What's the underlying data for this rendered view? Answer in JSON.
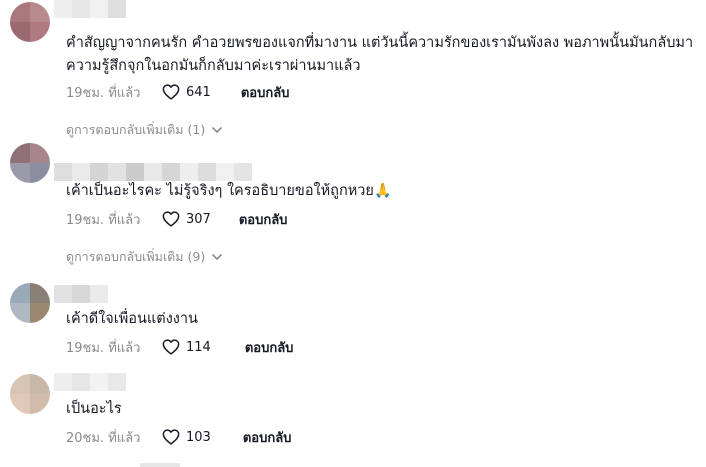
{
  "comments": [
    {
      "text": "คำสัญญาจากคนรัก คำอวยพรของแจกที่มางาน แต่วันนี้ความรักของเรามันพังลง พอภาพนั้นมันกลับมาความรู้สึกจุกในอกมันก็กลับมาค่ะเราผ่านมาแล้ว",
      "time": "19ชม. ที่แล้ว",
      "likes": "641",
      "reply_label": "ตอบกลับ",
      "more_replies": "ดูการตอบกลับเพิ่มเติม (1)"
    },
    {
      "text": "เค้าเป็นอะไรคะ ไม่รู้จริงๆ ใครอธิบายขอให้ถูกหวย",
      "emoji": "🙏",
      "time": "19ชม. ที่แล้ว",
      "likes": "307",
      "reply_label": "ตอบกลับ",
      "more_replies": "ดูการตอบกลับเพิ่มเติม (9)"
    },
    {
      "text": "เค้าดีใจเพื่อนแต่งงาน",
      "time": "19ชม. ที่แล้ว",
      "likes": "114",
      "reply_label": "ตอบกลับ"
    },
    {
      "text": "เป็นอะไร",
      "time": "20ชม. ที่แล้ว",
      "likes": "103",
      "reply_label": "ตอบกลับ"
    }
  ],
  "icons": {
    "like": "heart-outline-icon",
    "expand": "chevron-down-icon"
  },
  "colors": {
    "text": "#161823",
    "muted": "#8a8b91"
  }
}
